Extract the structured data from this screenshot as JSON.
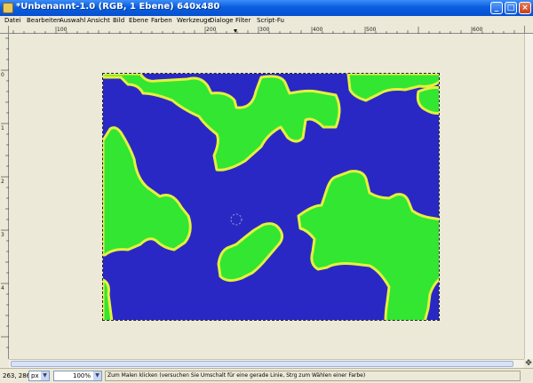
{
  "window": {
    "title": "*Unbenannt-1.0 (RGB, 1 Ebene) 640x480",
    "minimize_glyph": "_",
    "maximize_glyph": "□",
    "close_glyph": "×"
  },
  "menu": [
    "Datei",
    "Bearbeiten",
    "Auswahl",
    "Ansicht",
    "Bild",
    "Ebene",
    "Farben",
    "Werkzeuge",
    "Dialoge",
    "Filter",
    "Script-Fu"
  ],
  "rulers": {
    "horizontal_labels": [
      "100",
      "200",
      "300",
      "400",
      "500",
      "600"
    ],
    "vertical_labels": [
      "0",
      "1",
      "2",
      "3",
      "4"
    ]
  },
  "colors": {
    "water": "#2A28C4",
    "land": "#32E632",
    "shore": "#E6F03C",
    "canvas_bg": "#ECE9D8"
  },
  "status": {
    "coords": "263, 286",
    "unit": "px",
    "zoom": "100%",
    "message": "Zum Malen klicken (versuchen Sie Umschalt für eine gerade Linie, Strg zum Wählen einer Farbe)"
  },
  "icons": {
    "move": "move-cross-icon"
  }
}
